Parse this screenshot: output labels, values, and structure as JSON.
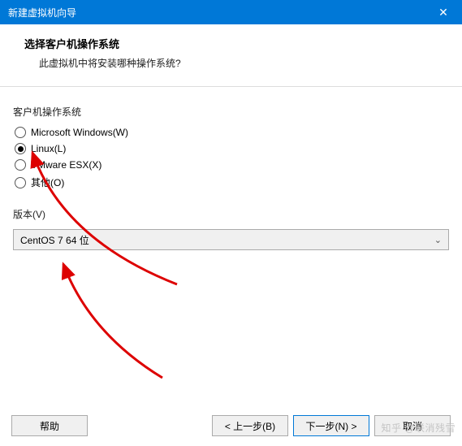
{
  "window": {
    "title": "新建虚拟机向导",
    "close_glyph": "✕"
  },
  "header": {
    "title": "选择客户机操作系统",
    "subtitle": "此虚拟机中将安装哪种操作系统?"
  },
  "os_group": {
    "label": "客户机操作系统",
    "options": [
      {
        "label": "Microsoft Windows(W)",
        "selected": false
      },
      {
        "label": "Linux(L)",
        "selected": true
      },
      {
        "label": "VMware ESX(X)",
        "selected": false
      },
      {
        "label": "其他(O)",
        "selected": false
      }
    ]
  },
  "version": {
    "label": "版本(V)",
    "selected": "CentOS 7 64 位"
  },
  "buttons": {
    "help": "帮助",
    "back": "< 上一步(B)",
    "next": "下一步(N) >",
    "cancel": "取消"
  },
  "watermark": "知乎 @联消残雪"
}
